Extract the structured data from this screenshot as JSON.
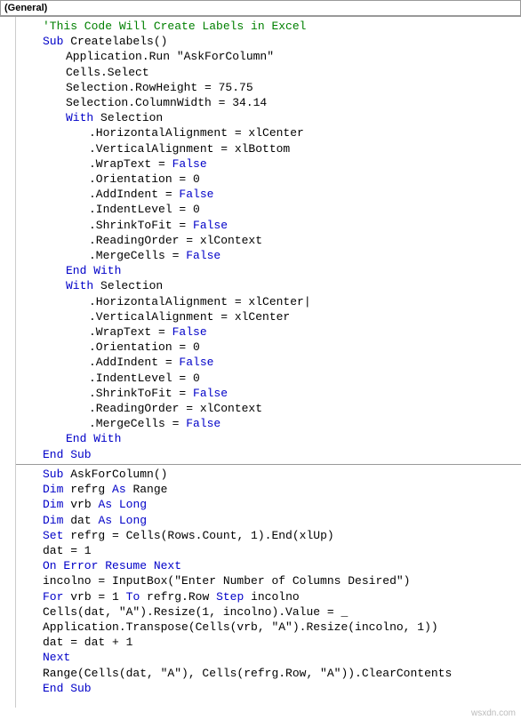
{
  "dropdown": {
    "selected": "(General)"
  },
  "code": {
    "lines": [
      {
        "ind": 2,
        "parts": [
          {
            "c": "comment",
            "t": "'This Code Will Create Labels in Excel"
          }
        ]
      },
      {
        "ind": 2,
        "parts": [
          {
            "c": "kw",
            "t": "Sub "
          },
          {
            "c": "txt",
            "t": "Createlabels()"
          }
        ]
      },
      {
        "ind": 3,
        "parts": [
          {
            "c": "txt",
            "t": "Application.Run \"AskForColumn\""
          }
        ]
      },
      {
        "ind": 3,
        "parts": [
          {
            "c": "txt",
            "t": "Cells.Select"
          }
        ]
      },
      {
        "ind": 3,
        "parts": [
          {
            "c": "txt",
            "t": "Selection.RowHeight = 75.75"
          }
        ]
      },
      {
        "ind": 3,
        "parts": [
          {
            "c": "txt",
            "t": "Selection.ColumnWidth = 34.14"
          }
        ]
      },
      {
        "ind": 3,
        "parts": [
          {
            "c": "kw",
            "t": "With "
          },
          {
            "c": "txt",
            "t": "Selection"
          }
        ]
      },
      {
        "ind": 4,
        "parts": [
          {
            "c": "txt",
            "t": ".HorizontalAlignment = xlCenter"
          }
        ]
      },
      {
        "ind": 4,
        "parts": [
          {
            "c": "txt",
            "t": ".VerticalAlignment = xlBottom"
          }
        ]
      },
      {
        "ind": 4,
        "parts": [
          {
            "c": "txt",
            "t": ".WrapText = "
          },
          {
            "c": "kw",
            "t": "False"
          }
        ]
      },
      {
        "ind": 4,
        "parts": [
          {
            "c": "txt",
            "t": ".Orientation = 0"
          }
        ]
      },
      {
        "ind": 4,
        "parts": [
          {
            "c": "txt",
            "t": ".AddIndent = "
          },
          {
            "c": "kw",
            "t": "False"
          }
        ]
      },
      {
        "ind": 4,
        "parts": [
          {
            "c": "txt",
            "t": ".IndentLevel = 0"
          }
        ]
      },
      {
        "ind": 4,
        "parts": [
          {
            "c": "txt",
            "t": ".ShrinkToFit = "
          },
          {
            "c": "kw",
            "t": "False"
          }
        ]
      },
      {
        "ind": 4,
        "parts": [
          {
            "c": "txt",
            "t": ".ReadingOrder = xlContext"
          }
        ]
      },
      {
        "ind": 4,
        "parts": [
          {
            "c": "txt",
            "t": ".MergeCells = "
          },
          {
            "c": "kw",
            "t": "False"
          }
        ]
      },
      {
        "ind": 3,
        "parts": [
          {
            "c": "kw",
            "t": "End With"
          }
        ]
      },
      {
        "ind": 3,
        "parts": [
          {
            "c": "kw",
            "t": "With "
          },
          {
            "c": "txt",
            "t": "Selection"
          }
        ]
      },
      {
        "ind": 4,
        "cursor": true,
        "parts": [
          {
            "c": "txt",
            "t": ".HorizontalAlignment = xlCenter"
          }
        ]
      },
      {
        "ind": 4,
        "parts": [
          {
            "c": "txt",
            "t": ".VerticalAlignment = xlCenter"
          }
        ]
      },
      {
        "ind": 4,
        "parts": [
          {
            "c": "txt",
            "t": ".WrapText = "
          },
          {
            "c": "kw",
            "t": "False"
          }
        ]
      },
      {
        "ind": 4,
        "parts": [
          {
            "c": "txt",
            "t": ".Orientation = 0"
          }
        ]
      },
      {
        "ind": 4,
        "parts": [
          {
            "c": "txt",
            "t": ".AddIndent = "
          },
          {
            "c": "kw",
            "t": "False"
          }
        ]
      },
      {
        "ind": 4,
        "parts": [
          {
            "c": "txt",
            "t": ".IndentLevel = 0"
          }
        ]
      },
      {
        "ind": 4,
        "parts": [
          {
            "c": "txt",
            "t": ".ShrinkToFit = "
          },
          {
            "c": "kw",
            "t": "False"
          }
        ]
      },
      {
        "ind": 4,
        "parts": [
          {
            "c": "txt",
            "t": ".ReadingOrder = xlContext"
          }
        ]
      },
      {
        "ind": 4,
        "parts": [
          {
            "c": "txt",
            "t": ".MergeCells = "
          },
          {
            "c": "kw",
            "t": "False"
          }
        ]
      },
      {
        "ind": 3,
        "parts": [
          {
            "c": "kw",
            "t": "End With"
          }
        ]
      },
      {
        "ind": 2,
        "parts": [
          {
            "c": "kw",
            "t": "End Sub"
          }
        ]
      },
      {
        "divider": true
      },
      {
        "ind": 2,
        "parts": [
          {
            "c": "kw",
            "t": "Sub "
          },
          {
            "c": "txt",
            "t": "AskForColumn()"
          }
        ]
      },
      {
        "ind": 2,
        "parts": [
          {
            "c": "kw",
            "t": "Dim "
          },
          {
            "c": "txt",
            "t": "refrg "
          },
          {
            "c": "kw",
            "t": "As "
          },
          {
            "c": "txt",
            "t": "Range"
          }
        ]
      },
      {
        "ind": 2,
        "parts": [
          {
            "c": "kw",
            "t": "Dim "
          },
          {
            "c": "txt",
            "t": "vrb "
          },
          {
            "c": "kw",
            "t": "As Long"
          }
        ]
      },
      {
        "ind": 2,
        "parts": [
          {
            "c": "kw",
            "t": "Dim "
          },
          {
            "c": "txt",
            "t": "dat "
          },
          {
            "c": "kw",
            "t": "As Long"
          }
        ]
      },
      {
        "ind": 2,
        "parts": [
          {
            "c": "kw",
            "t": "Set "
          },
          {
            "c": "txt",
            "t": "refrg = Cells(Rows.Count, 1).End(xlUp)"
          }
        ]
      },
      {
        "ind": 2,
        "parts": [
          {
            "c": "txt",
            "t": "dat = 1"
          }
        ]
      },
      {
        "ind": 2,
        "parts": [
          {
            "c": "kw",
            "t": "On Error Resume Next"
          }
        ]
      },
      {
        "ind": 2,
        "parts": [
          {
            "c": "txt",
            "t": "incolno = InputBox(\"Enter Number of Columns Desired\")"
          }
        ]
      },
      {
        "ind": 2,
        "parts": [
          {
            "c": "kw",
            "t": "For "
          },
          {
            "c": "txt",
            "t": "vrb = 1 "
          },
          {
            "c": "kw",
            "t": "To "
          },
          {
            "c": "txt",
            "t": "refrg.Row "
          },
          {
            "c": "kw",
            "t": "Step "
          },
          {
            "c": "txt",
            "t": "incolno"
          }
        ]
      },
      {
        "ind": 2,
        "parts": [
          {
            "c": "txt",
            "t": "Cells(dat, \"A\").Resize(1, incolno).Value = _"
          }
        ]
      },
      {
        "ind": 2,
        "parts": [
          {
            "c": "txt",
            "t": "Application.Transpose(Cells(vrb, \"A\").Resize(incolno, 1))"
          }
        ]
      },
      {
        "ind": 2,
        "parts": [
          {
            "c": "txt",
            "t": "dat = dat + 1"
          }
        ]
      },
      {
        "ind": 2,
        "parts": [
          {
            "c": "kw",
            "t": "Next"
          }
        ]
      },
      {
        "ind": 2,
        "parts": [
          {
            "c": "txt",
            "t": "Range(Cells(dat, \"A\"), Cells(refrg.Row, \"A\")).ClearContents"
          }
        ]
      },
      {
        "ind": 2,
        "parts": [
          {
            "c": "kw",
            "t": "End Sub"
          }
        ]
      }
    ]
  },
  "watermark": "wsxdn.com"
}
